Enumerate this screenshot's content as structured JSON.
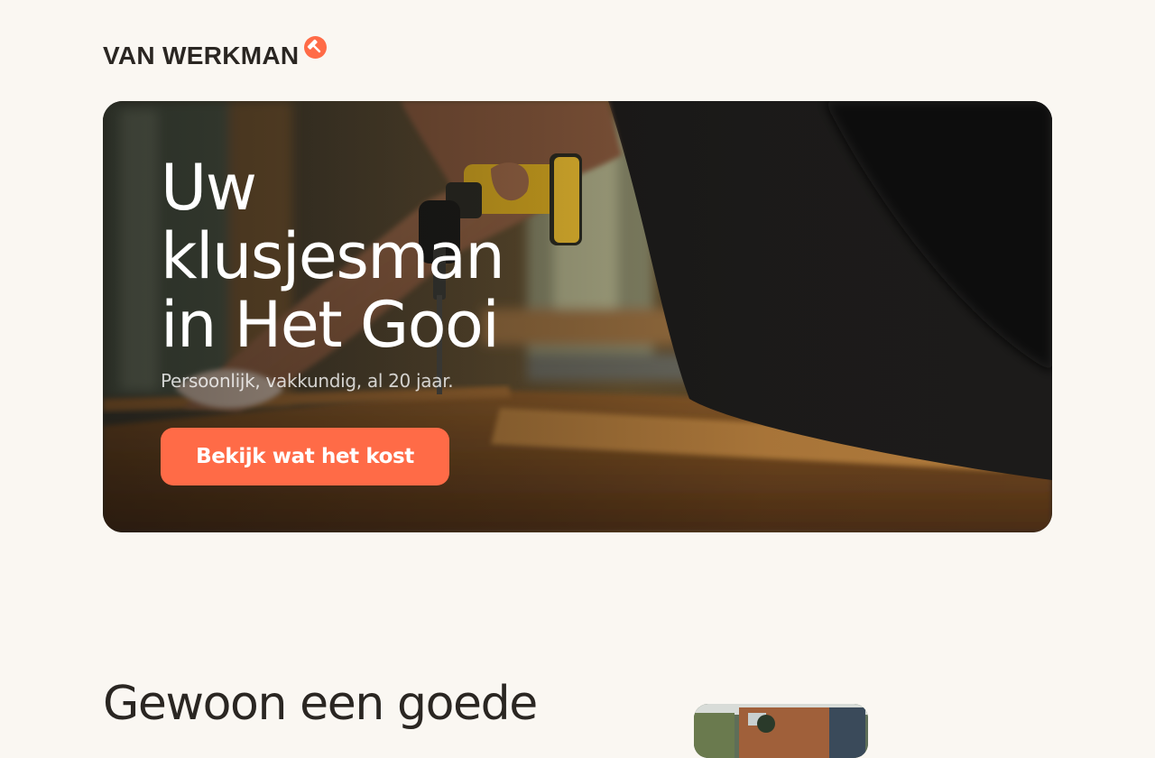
{
  "brand": {
    "name": "VAN WERKMAN",
    "logo_icon": "hammer-icon",
    "accent_color": "#ff6b47"
  },
  "hero": {
    "title_lines": [
      "Uw",
      "klusjesman",
      "in Het Gooi"
    ],
    "subtitle": "Persoonlijk, vakkundig, al 20 jaar.",
    "cta_label": "Bekijk wat het kost",
    "image": "handyman-drilling-photo"
  },
  "intro": {
    "heading": "Gewoon een goede",
    "image": "house-exterior-photo"
  }
}
